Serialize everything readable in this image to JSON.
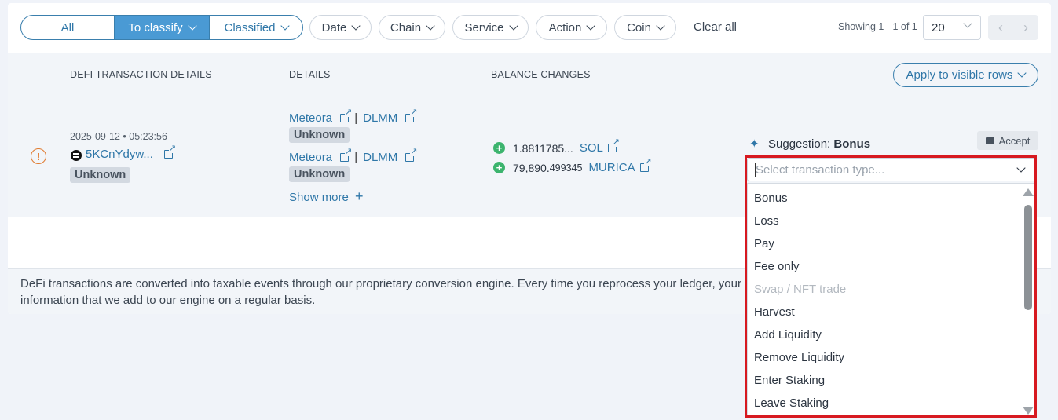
{
  "filters": {
    "segments": [
      "All",
      "To classify",
      "Classified"
    ],
    "dropdowns": [
      "Date",
      "Chain",
      "Service",
      "Action",
      "Coin"
    ],
    "clear_all": "Clear all"
  },
  "pagination": {
    "showing": "Showing 1 - 1 of 1",
    "per_page": "20"
  },
  "table": {
    "headers": [
      "DEFI TRANSACTION DETAILS",
      "DETAILS",
      "BALANCE CHANGES"
    ],
    "apply_button": "Apply to visible rows",
    "row": {
      "datetime": "2025-09-12 • 05:23:56",
      "tx_hash": "5KCnYdyw...",
      "status_tag": "Unknown",
      "details": [
        {
          "protocol": "Meteora",
          "pool": "DLMM",
          "tag": "Unknown"
        },
        {
          "protocol": "Meteora",
          "pool": "DLMM",
          "tag": "Unknown"
        }
      ],
      "show_more": "Show more",
      "balance_changes": [
        {
          "amount_main": "1.8811785...",
          "amount_small": "",
          "coin": "SOL"
        },
        {
          "amount_main": "79,890.",
          "amount_small": "499345",
          "coin": "MURICA"
        }
      ],
      "suggestion_label": "Suggestion:",
      "suggestion_value": "Bonus",
      "accept": "Accept"
    }
  },
  "transaction_type_select": {
    "placeholder": "Select transaction type...",
    "options": [
      {
        "label": "Bonus",
        "disabled": false
      },
      {
        "label": "Loss",
        "disabled": false
      },
      {
        "label": "Pay",
        "disabled": false
      },
      {
        "label": "Fee only",
        "disabled": false
      },
      {
        "label": "Swap / NFT trade",
        "disabled": true
      },
      {
        "label": "Harvest",
        "disabled": false
      },
      {
        "label": "Add Liquidity",
        "disabled": false
      },
      {
        "label": "Remove Liquidity",
        "disabled": false
      },
      {
        "label": "Enter Staking",
        "disabled": false
      },
      {
        "label": "Leave Staking",
        "disabled": false
      }
    ]
  },
  "footer_note": {
    "line1": "DeFi transactions are converted into taxable events through our proprietary conversion engine. Every time you reprocess your ledger, your De",
    "line2": "information that we add to our engine on a regular basis."
  },
  "colors": {
    "accent": "#2f77a8",
    "segment_active": "#4a9ad4",
    "warning": "#e07a2f",
    "positive": "#3cb46e",
    "highlight_border": "#d71920"
  }
}
